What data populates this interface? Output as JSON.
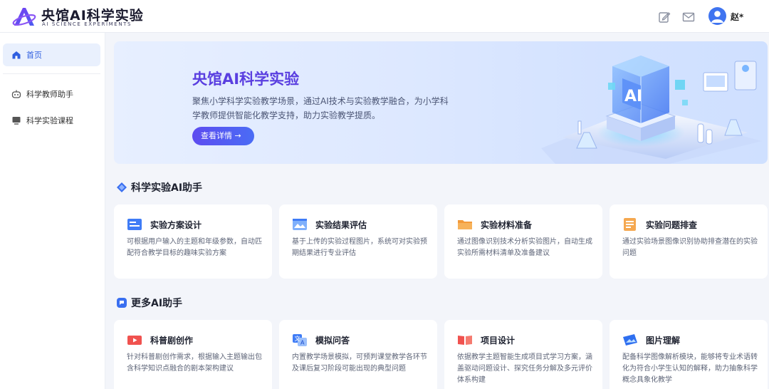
{
  "header": {
    "logo_title": "央馆AI科学实验",
    "logo_subtitle": "AI SCIENCE EXPERIMENTS",
    "user_name": "赵*"
  },
  "sidebar": {
    "items": [
      {
        "label": "首页",
        "icon": "home-icon",
        "active": true
      },
      {
        "label": "科学教师助手",
        "icon": "robot-icon",
        "active": false
      },
      {
        "label": "科学实验课程",
        "icon": "monitor-icon",
        "active": false
      }
    ]
  },
  "banner": {
    "title": "央馆AI科学实验",
    "description": "聚焦小学科学实验教学场景，通过AI技术与实验教学融合，为小学科学教师提供智能化教学支持，助力实验教学提质。",
    "button_label": "查看详情 →",
    "art_text": "AI"
  },
  "sections": [
    {
      "title": "科学实验AI助手",
      "icon": "diamond-icon",
      "cards": [
        {
          "title": "实验方案设计",
          "icon": "plan-icon",
          "color": "#3f7cf6",
          "desc": "可根据用户输入的主题和年级参数，自动匹配符合教学目标的趣味实验方案"
        },
        {
          "title": "实验结果评估",
          "icon": "image-eval-icon",
          "color": "#4b8ef7",
          "desc": "基于上传的实验过程图片，系统可对实验预期结果进行专业评估"
        },
        {
          "title": "实验材料准备",
          "icon": "folder-icon",
          "color": "#f39a3a",
          "desc": "通过图像识别技术分析实验图片，自动生成实验所需材料清单及准备建议"
        },
        {
          "title": "实验问题排查",
          "icon": "checklist-icon",
          "color": "#f5a850",
          "desc": "通过实验场景图像识别协助排查潜在的实验问题"
        }
      ]
    },
    {
      "title": "更多AI助手",
      "icon": "chat-bubble-icon",
      "cards": [
        {
          "title": "科普剧创作",
          "icon": "video-icon",
          "color": "#f0524f",
          "desc": "针对科普剧创作需求，根据输入主题输出包含科学知识点融合的剧本架构建议"
        },
        {
          "title": "模拟问答",
          "icon": "translate-icon",
          "color": "#3f7cf6",
          "desc": "内置教学场景模拟，可预判课堂教学各环节及课后复习阶段可能出现的典型问题"
        },
        {
          "title": "项目设计",
          "icon": "book-icon",
          "color": "#f0524f",
          "desc": "依据教学主题智能生成项目式学习方案，涵盖驱动问题设计、探究任务分解及多元评价体系构建"
        },
        {
          "title": "图片理解",
          "icon": "picture-icon",
          "color": "#2f6ff0",
          "desc": "配备科学图像解析模块，能够将专业术语转化为符合小学生认知的解释，助力抽象科学概念具象化教学"
        }
      ]
    }
  ]
}
